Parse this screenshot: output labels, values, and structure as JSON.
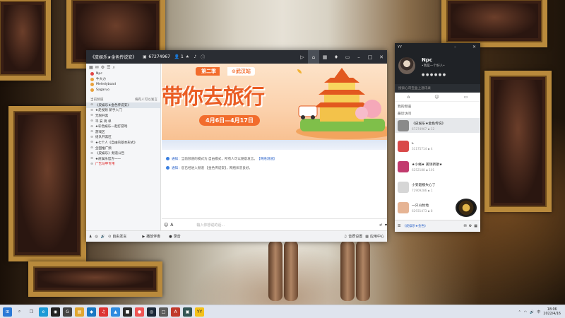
{
  "window": {
    "title": "《皮娱乐★金色传说安》",
    "channel_id": "67274967",
    "member_count": "1"
  },
  "sidebar": {
    "top_members": [
      {
        "name": "Npc",
        "color": "#e24545"
      },
      {
        "name": "牛大力",
        "color": "#e9a13b"
      },
      {
        "name": "Meledyboad",
        "color": "#e9a13b"
      },
      {
        "name": "Sagaruo",
        "color": "#e9a13b"
      }
    ],
    "section_label": "当前频道",
    "section_action": "将有人可以发言",
    "channels": [
      {
        "label": "《皮娱乐★金色传说安》",
        "selected": true,
        "red": false
      },
      {
        "label": "★走视频 新手入门",
        "selected": false,
        "red": false
      },
      {
        "label": "无限开黑",
        "selected": false,
        "red": false
      },
      {
        "label": "平 安 简 单",
        "selected": false,
        "red": false
      },
      {
        "label": "★彩色娱乐一起打游戏",
        "selected": false,
        "red": false
      },
      {
        "label": "游戏区",
        "selected": false,
        "red": false
      },
      {
        "label": "组队开黑区",
        "selected": false,
        "red": false
      },
      {
        "label": "★七个人《自由的基本形式》",
        "selected": false,
        "red": false
      },
      {
        "label": "全国推广频",
        "selected": false,
        "red": false
      },
      {
        "label": "《皮娱乐》频道公告",
        "selected": false,
        "red": false
      },
      {
        "label": "★皮娱乐官方一一",
        "selected": false,
        "red": false
      },
      {
        "label": "广告马甲专用",
        "selected": false,
        "red": true
      }
    ]
  },
  "banner": {
    "season": "第二季",
    "location": "武汉站",
    "title": "带你去旅行",
    "dates": "4月6日—4月17日"
  },
  "notices": [
    {
      "prefix": "通知：",
      "text": "当前频道的模式为 自由模式，所有人可以随意发言。",
      "link": "【网络测速】"
    },
    {
      "prefix": "通知：",
      "text": "您已经进入频道 【金色传说安】，网络状况良好。",
      "link": ""
    }
  ],
  "input": {
    "placeholder": "输入你想说的话..."
  },
  "bottom_bar": {
    "speak_label": "自由发言",
    "play_label": "播放伴奏",
    "record_label": "录音",
    "quality_label": "音质设置",
    "app_label": "应用中心"
  },
  "panel": {
    "title": "YY",
    "name": "Npc",
    "signature": "•我是一个好人•",
    "search_placeholder": "搜索心哥宝盒上通讯录",
    "section_mine": "我的频道",
    "section_recent": "最近访问",
    "recent": [
      {
        "name": "《皮娱乐★金色传说》",
        "id": "67274967",
        "count": "12",
        "color": "#8a8a8a",
        "selected": true
      },
      {
        "name": "L",
        "id": "31175714",
        "count": "4",
        "color": "#d94a4a",
        "selected": false
      },
      {
        "name": "★小蝇★ 美领新歌★",
        "id": "6252188",
        "count": "101",
        "color": "#c23b6e",
        "selected": false
      },
      {
        "name": "小安超模失心了",
        "id": "72909286",
        "count": "1",
        "color": "#d6d6d6",
        "selected": false
      },
      {
        "name": "一只山豹地",
        "id": "62931473",
        "count": "8",
        "color": "#e6b494",
        "selected": false
      }
    ],
    "bottom_label": "《皮娱乐★金色》"
  },
  "taskbar": {
    "time": "18:06",
    "date": "2022/4/16",
    "lang": "中"
  }
}
